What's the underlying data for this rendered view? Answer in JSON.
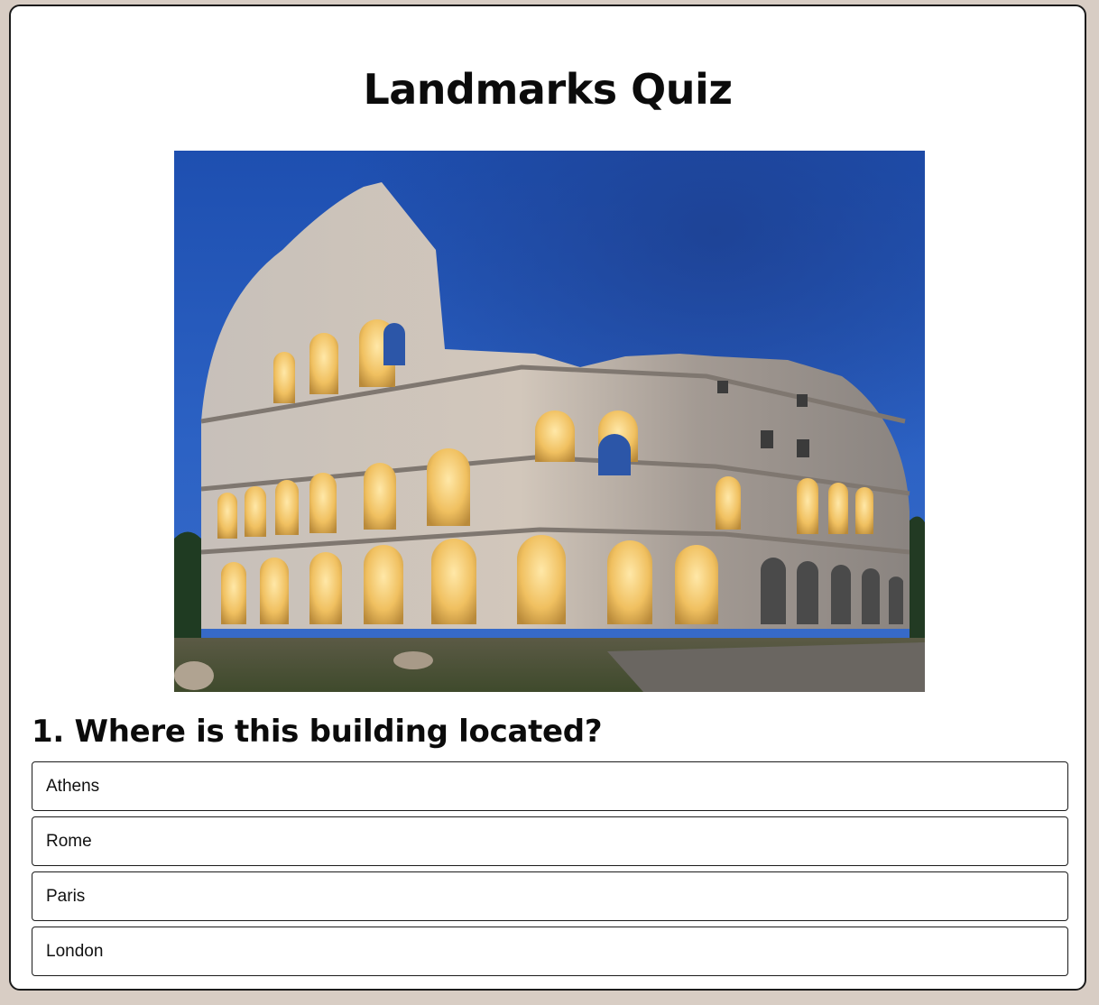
{
  "quiz": {
    "title": "Landmarks Quiz",
    "image_subject": "Colosseum at dusk",
    "question": {
      "number_and_text": "1. Where is this building located?",
      "options": [
        "Athens",
        "Rome",
        "Paris",
        "London"
      ]
    }
  },
  "colors": {
    "page_background": "#d8cdc4",
    "card_background": "#ffffff",
    "border": "#1b1b1b",
    "sky": "#2a5fc0"
  }
}
